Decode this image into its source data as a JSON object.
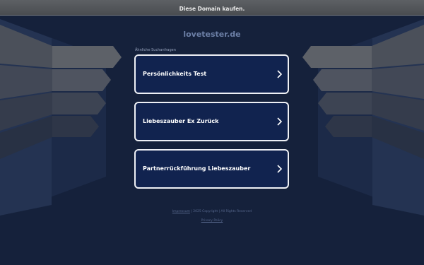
{
  "banner": {
    "text": "Diese Domain kaufen."
  },
  "site": {
    "domain": "lovetester.de"
  },
  "related": {
    "heading": "Ähnliche Suchanfragen",
    "items": [
      {
        "label": "Persönlichkeits Test"
      },
      {
        "label": "Liebeszauber Ex Zurück"
      },
      {
        "label": "Partnerrückführung Liebeszauber"
      }
    ]
  },
  "footer": {
    "imprint": "Impressum",
    "copyright": "2025 Copyright",
    "rights": "All Rights Reserved",
    "privacy": "Privacy Policy",
    "separator": "|"
  },
  "colors": {
    "background": "#15213b",
    "card": "#11234f",
    "card_border": "#eef0f5"
  }
}
